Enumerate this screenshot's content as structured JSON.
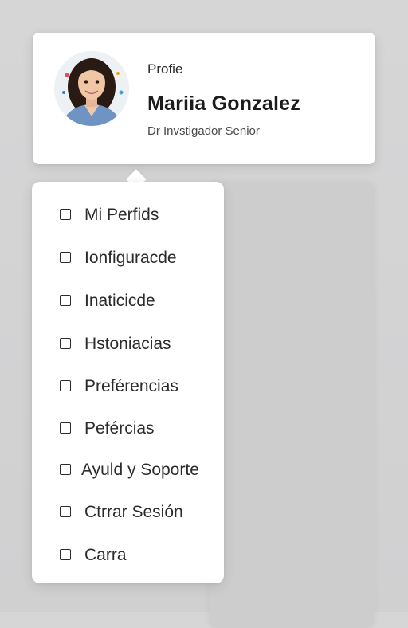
{
  "profile": {
    "label": "Profie",
    "name": "Mariia Gonzalez",
    "role": "Dr Invstigador Senior",
    "avatar_icon": "person-avatar"
  },
  "menu": {
    "items": [
      {
        "label": "Mi Perfids",
        "icon": "checkbox-icon"
      },
      {
        "label": "Ionfiguracde",
        "icon": "checkbox-icon"
      },
      {
        "label": "Inaticicde",
        "icon": "checkbox-icon"
      },
      {
        "label": "Hstoniacias",
        "icon": "checkbox-icon"
      },
      {
        "label": "Preférencias",
        "icon": "checkbox-icon"
      },
      {
        "label": "Pefércias",
        "icon": "checkbox-icon"
      },
      {
        "label": "Ayuld y Soporte",
        "icon": "checkbox-icon"
      },
      {
        "label": "Ctrrar Sesión",
        "icon": "checkbox-icon"
      },
      {
        "label": "Carra",
        "icon": "checkbox-icon"
      }
    ]
  }
}
